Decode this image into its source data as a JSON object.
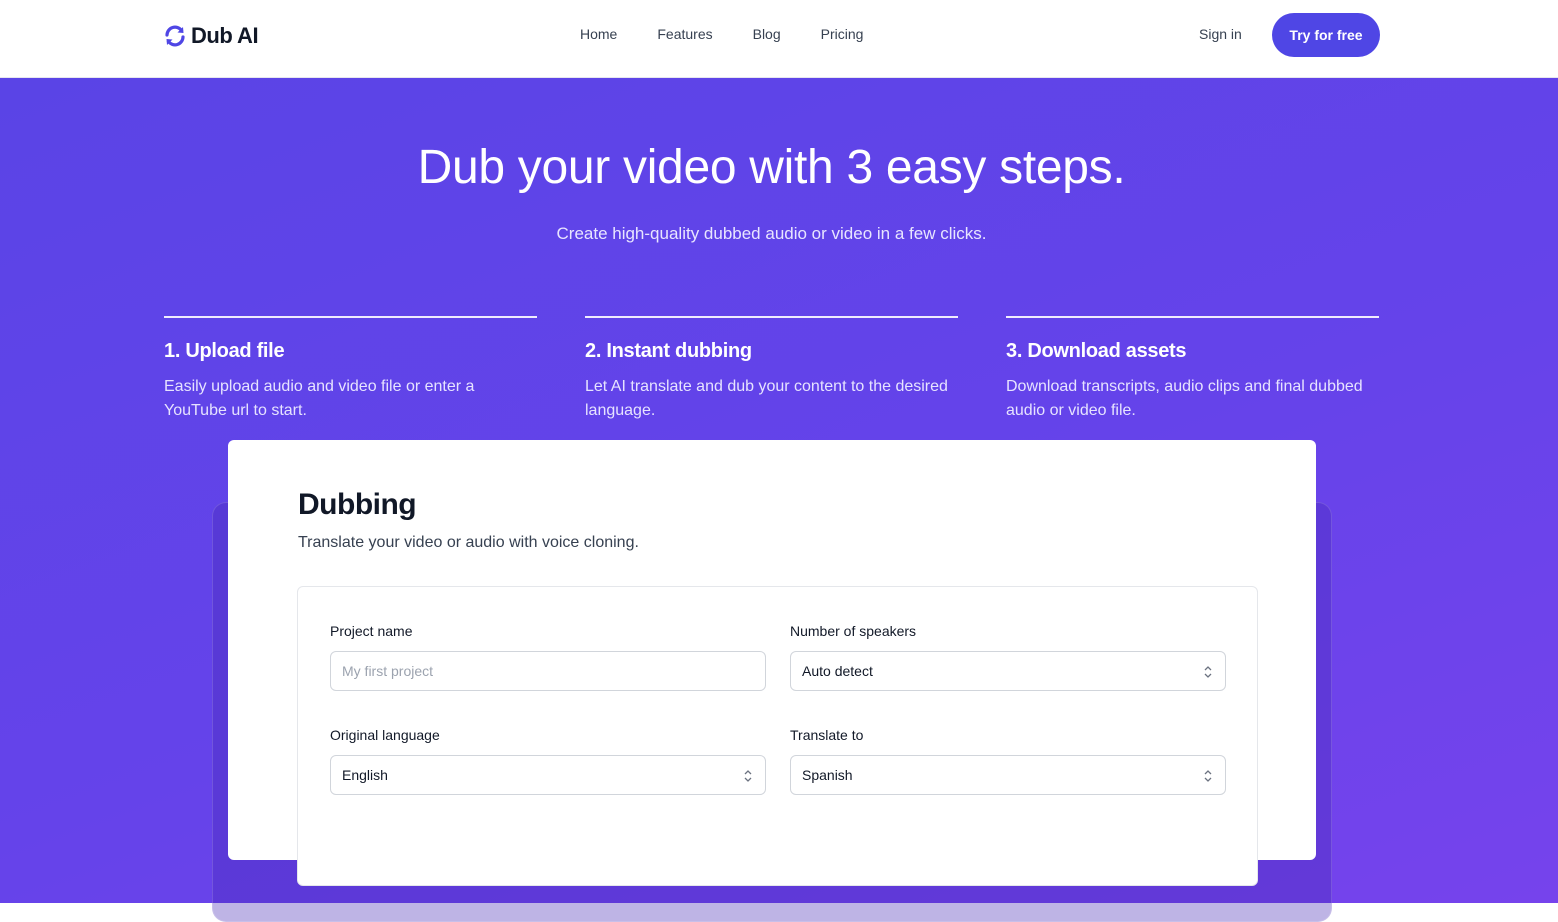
{
  "brand": {
    "name": "Dub AI",
    "accent": "#4f46e5"
  },
  "nav": {
    "items": [
      "Home",
      "Features",
      "Blog",
      "Pricing"
    ]
  },
  "auth": {
    "sign_in": "Sign in",
    "try_free": "Try for free"
  },
  "hero": {
    "title": "Dub your video with 3 easy steps.",
    "subtitle": "Create high-quality dubbed audio or video in a few clicks."
  },
  "steps": [
    {
      "title": "1. Upload file",
      "desc": "Easily upload audio and video file or enter a YouTube url to start."
    },
    {
      "title": "2. Instant dubbing",
      "desc": "Let AI translate and dub your content to the desired language."
    },
    {
      "title": "3. Download assets",
      "desc": "Download transcripts, audio clips and final dubbed audio or video file."
    }
  ],
  "dubbing": {
    "title": "Dubbing",
    "subtitle": "Translate your video or audio with voice cloning.",
    "project_name": {
      "label": "Project name",
      "placeholder": "My first project",
      "value": ""
    },
    "speakers": {
      "label": "Number of speakers",
      "value": "Auto detect"
    },
    "original_language": {
      "label": "Original language",
      "value": "English"
    },
    "translate_to": {
      "label": "Translate to",
      "value": "Spanish"
    }
  }
}
